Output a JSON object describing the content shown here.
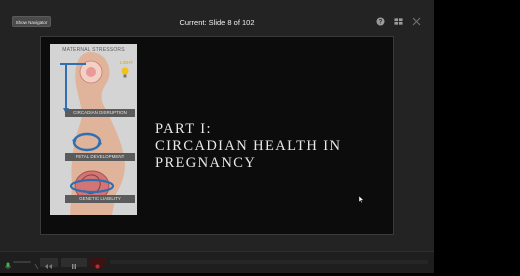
{
  "toolbar": {
    "show_navigator_label": "Show Navigator",
    "slide_counter": "Current: Slide 8 of 102"
  },
  "slide": {
    "figure": {
      "title": "MATERNAL STRESSORS",
      "light_label": "LIGHT",
      "bands": [
        "CIRCADIAN DISRUPTION",
        "FETAL DEVELOPMENT",
        "GENETIC LIABILITY"
      ]
    },
    "title_lines": [
      "PART I:",
      "CIRCADIAN HEALTH IN",
      "PREGNANCY"
    ]
  },
  "colors": {
    "viewer_bg": "#232323",
    "slide_bg": "#0c0c0c",
    "figure_bg": "#d4d4d4",
    "arrow_blue": "#2f6fb3",
    "record_red": "#c62828"
  },
  "icons": [
    "help-icon",
    "grid-view-icon",
    "close-icon",
    "mic-icon",
    "rewind-icon",
    "pause-icon",
    "record-icon",
    "cursor-icon"
  ]
}
